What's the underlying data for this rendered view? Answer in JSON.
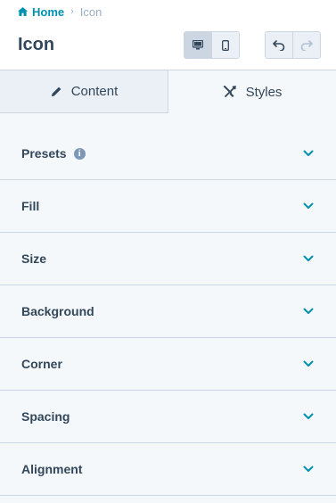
{
  "breadcrumb": {
    "home_label": "Home",
    "current_label": "Icon"
  },
  "page_title": "Icon",
  "toolbar": {
    "device_buttons": [
      "desktop-icon",
      "mobile-icon"
    ],
    "active_device": "desktop",
    "history_buttons": [
      "undo-icon",
      "redo-icon"
    ],
    "redo_enabled": false
  },
  "tabs": [
    {
      "label": "Content",
      "icon": "pencil-icon",
      "active": false
    },
    {
      "label": "Styles",
      "icon": "brush-icon",
      "active": true
    }
  ],
  "sections": [
    {
      "label": "Presets",
      "info": true
    },
    {
      "label": "Fill"
    },
    {
      "label": "Size"
    },
    {
      "label": "Background"
    },
    {
      "label": "Corner"
    },
    {
      "label": "Spacing"
    },
    {
      "label": "Alignment"
    }
  ],
  "colors": {
    "accent": "#0091ae",
    "text": "#33475b",
    "border": "#cbd6e2",
    "background": "#f5f8fa"
  }
}
